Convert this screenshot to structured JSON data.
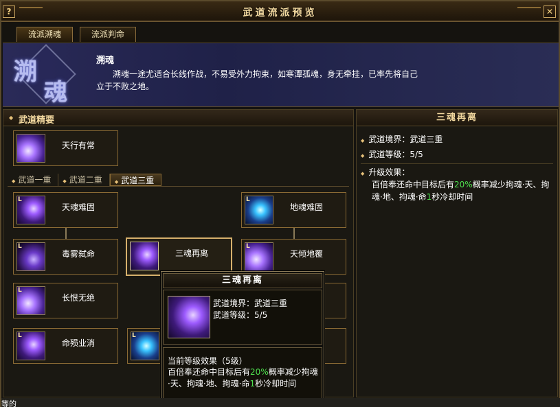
{
  "window": {
    "title": "武道流派预览",
    "help_label": "?",
    "close_label": "✕"
  },
  "tabs": [
    {
      "label": "流派溯魂"
    },
    {
      "label": "流派判命"
    }
  ],
  "banner": {
    "emblem_chars": [
      "溯",
      "魂"
    ],
    "school_name": "溯魂",
    "description": "溯魂一途尤适合长线作战，不易受外力拘束，如寒潭孤魂，身无牵挂，已率先将自己立于不败之地。"
  },
  "left": {
    "section_title": "武道精要",
    "essence_skill": {
      "name": "天行有常",
      "icon": "purple-storm-icon"
    },
    "sub_tabs": [
      {
        "label": "武道一重"
      },
      {
        "label": "武道二重"
      },
      {
        "label": "武道三重"
      }
    ],
    "active_sub_tab": 2,
    "skills": {
      "s1": {
        "name": "天魂难固",
        "rank": "L"
      },
      "s2": {
        "name": "地魂难固",
        "rank": "L"
      },
      "s3": {
        "name": "毒雾弑命",
        "rank": "L"
      },
      "s4": {
        "name": "三魂再离",
        "rank": ""
      },
      "s5": {
        "name": "天倾地覆",
        "rank": "L"
      },
      "s6": {
        "name": "长恨无绝",
        "rank": "L"
      },
      "s7": {
        "name": "命殒业消",
        "rank": "L"
      },
      "s8": {
        "name": "",
        "rank": "L"
      }
    }
  },
  "right": {
    "title": "三魂再离",
    "realm": "武道境界：武道三重",
    "level": "武道等级：5/5",
    "effect_title": "升级效果：",
    "effect_pre": "百倍奉还命中目标后有",
    "effect_pct": "20%",
    "effect_mid": "概率减少拘魂·天、拘魂·地、拘魂·命",
    "effect_num": "1",
    "effect_post": "秒冷却时间"
  },
  "tooltip": {
    "title": "三魂再离",
    "realm": "武道境界：武道三重",
    "level": "武道等级：5/5",
    "current_label": "当前等级效果（5级）",
    "effect_pre": "百倍奉还命中目标后有",
    "effect_pct": "20%",
    "effect_mid": "概率减少拘魂·天、拘魂·地、拘魂·命",
    "effect_num": "1",
    "effect_post": "秒冷却时间"
  },
  "bottom": {
    "cut_text": "等的"
  },
  "colors": {
    "accent_gold": "#f3d9a0",
    "highlight_green": "#4ee04e",
    "frame": "#8a6a34"
  }
}
